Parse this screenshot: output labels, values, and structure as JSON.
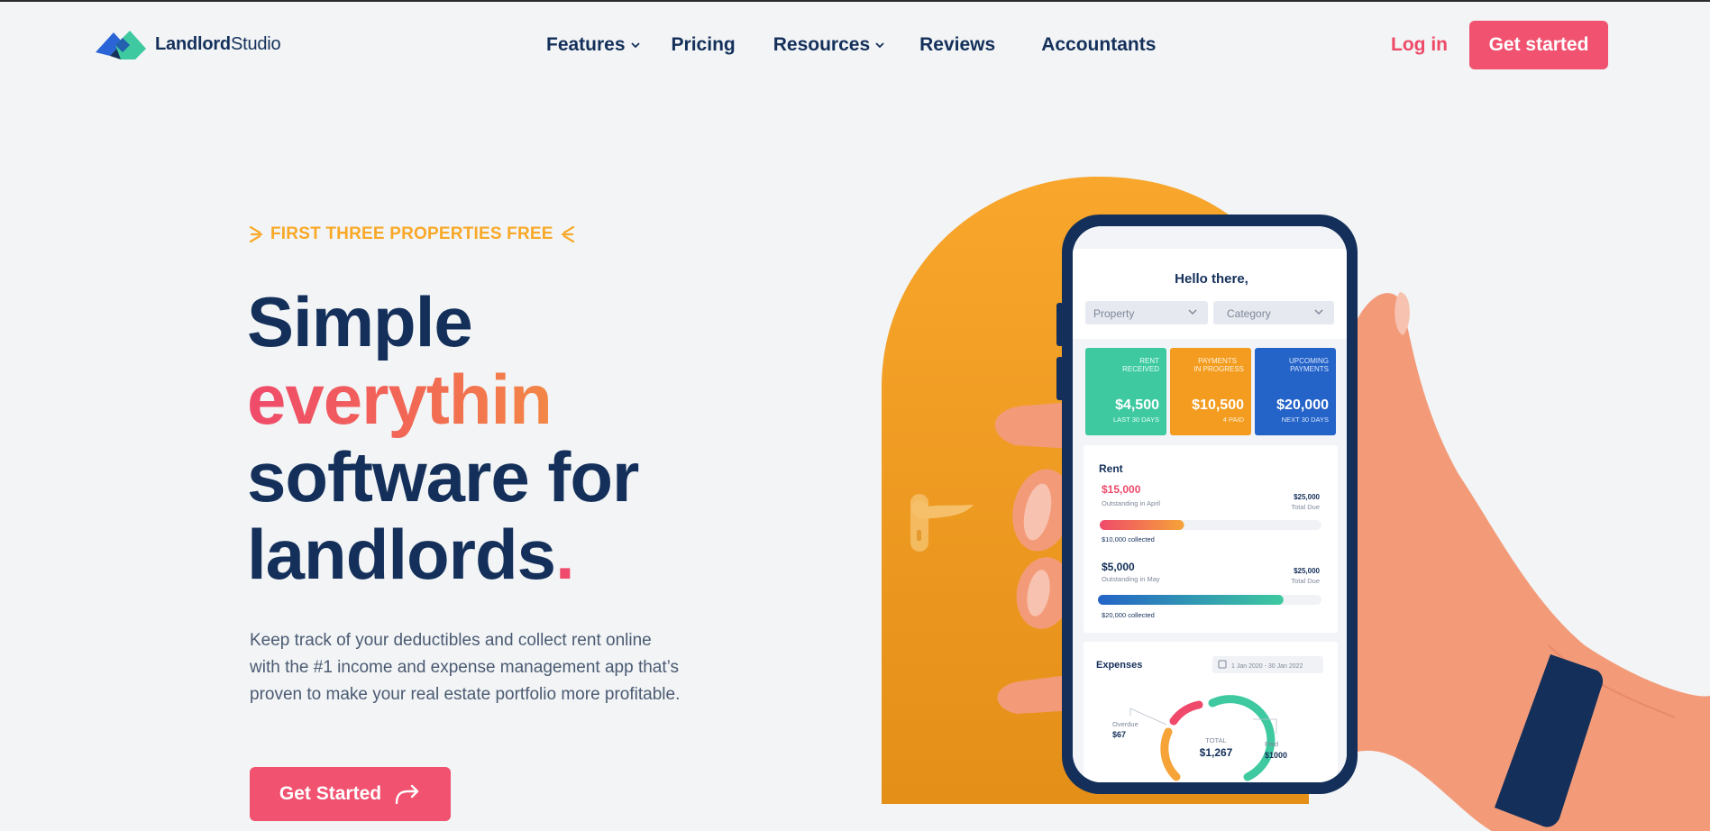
{
  "nav": {
    "logo_bold": "Landlord",
    "logo_regular": "Studio",
    "items": [
      {
        "label": "Features",
        "dropdown": true
      },
      {
        "label": "Pricing",
        "dropdown": false
      },
      {
        "label": "Resources",
        "dropdown": true
      },
      {
        "label": "Reviews",
        "dropdown": false
      },
      {
        "label": "Accountants",
        "dropdown": false
      }
    ],
    "login": "Log in",
    "cta": "Get started"
  },
  "hero": {
    "eyebrow": "FIRST THREE PROPERTIES FREE",
    "headline_1": "Simple",
    "headline_2": "everythin",
    "headline_3": "software for",
    "headline_4": "landlords",
    "headline_dot": ".",
    "description": "Keep track of your deductibles and collect rent online with the #1 income and expense management app that’s proven to make your real estate portfolio more profitable.",
    "cta": "Get Started"
  },
  "phone": {
    "greeting": "Hello there,",
    "filter_property": "Property",
    "filter_category": "Category",
    "cards": [
      {
        "title_1": "RENT",
        "title_2": "RECEIVED",
        "amount": "$4,500",
        "sub": "LAST 30 DAYS",
        "color": "#3ec9a0"
      },
      {
        "title_1": "PAYMENTS",
        "title_2": "IN PROGRESS",
        "amount": "$10,500",
        "sub": "4 PAID",
        "color": "#f39c1f"
      },
      {
        "title_1": "UPCOMING",
        "title_2": "PAYMENTS",
        "amount": "$20,000",
        "sub": "NEXT 30 DAYS",
        "color": "#2463c7"
      }
    ],
    "rent": {
      "title": "Rent",
      "rows": [
        {
          "amount": "$15,000",
          "label": "Outstanding in April",
          "total": "$25,000",
          "total_label": "Total Due",
          "collected": "$10,000 collected",
          "progress": 0.38
        },
        {
          "amount": "$5,000",
          "label": "Outstanding in May",
          "total": "$25,000",
          "total_label": "Total Due",
          "collected": "$20,000 collected",
          "progress": 0.83
        }
      ]
    },
    "expenses": {
      "title": "Expenses",
      "date_range": "1 Jan 2020  -  30 Jan 2022",
      "overdue_label": "Overdue",
      "overdue_value": "$67",
      "total_label": "TOTAL",
      "total_value": "$1,267",
      "paid_label": "Paid",
      "paid_value": "$1000"
    }
  },
  "colors": {
    "navy": "#14305a",
    "pink": "#f05270",
    "orange": "#f9a827",
    "background": "#f2f4f6"
  }
}
